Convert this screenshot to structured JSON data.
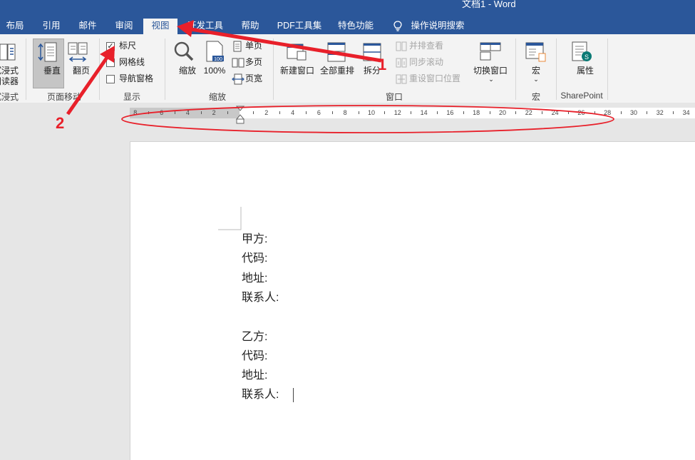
{
  "window": {
    "title": "文档1  -  Word"
  },
  "tabs": [
    {
      "label": "布局"
    },
    {
      "label": "引用"
    },
    {
      "label": "邮件"
    },
    {
      "label": "审阅"
    },
    {
      "label": "视图",
      "active": true
    },
    {
      "label": "开发工具"
    },
    {
      "label": "帮助"
    },
    {
      "label": "PDF工具集"
    },
    {
      "label": "特色功能"
    }
  ],
  "tell_me": {
    "label": "操作说明搜索"
  },
  "ribbon": {
    "immersive": {
      "button_line1": "沉浸式",
      "button_line2": "阅读器",
      "group_label": "沉浸式"
    },
    "page_movement": {
      "vertical_label": "垂直",
      "flip_label": "翻页",
      "group_label": "页面移动"
    },
    "show": {
      "group_label": "显示",
      "ruler": {
        "label": "标尺",
        "checked": true
      },
      "gridlines": {
        "label": "网格线",
        "checked": false
      },
      "nav_pane": {
        "label": "导航窗格",
        "checked": false
      }
    },
    "zoom": {
      "zoom_label": "缩放",
      "hundred_label": "100%",
      "one_page": "单页",
      "multi_page": "多页",
      "page_width": "页宽",
      "group_label": "缩放"
    },
    "window": {
      "new_window": "新建窗口",
      "arrange_all": "全部重排",
      "split": "拆分",
      "side_by_side": "并排查看",
      "sync_scroll": "同步滚动",
      "reset_pos": "重设窗口位置",
      "switch_windows": "切换窗口",
      "group_label": "窗口"
    },
    "macros": {
      "label": "宏",
      "group_label": "宏"
    },
    "sharepoint": {
      "label": "属性",
      "group_label": "SharePoint"
    }
  },
  "ruler": {
    "left_numbers": [
      "8",
      "6",
      "4",
      "2"
    ],
    "right_numbers": [
      "2",
      "4",
      "6",
      "8",
      "10",
      "12",
      "14",
      "16",
      "18",
      "20",
      "22",
      "24",
      "26",
      "28",
      "30",
      "32",
      "34"
    ]
  },
  "document": {
    "lines": [
      "甲方:",
      "代码:",
      "地址:",
      "联系人:",
      "",
      "乙方:",
      "代码:",
      "地址:",
      "联系人:"
    ]
  },
  "annotations": {
    "marker1": "1",
    "marker2": "2",
    "color": "#e8202a"
  }
}
